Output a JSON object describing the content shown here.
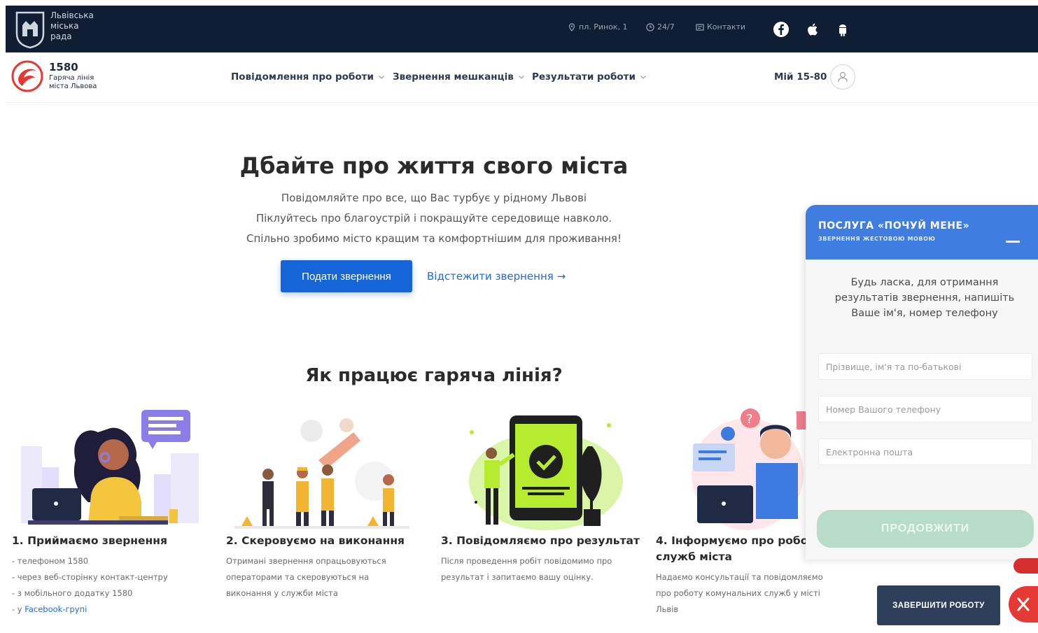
{
  "topbar": {
    "city_name_lines": [
      "Львівська",
      "міська",
      "рада"
    ],
    "address": "пл. Ринок, 1",
    "hours": "24/7",
    "contacts": "Контакти",
    "icons": [
      "location-icon",
      "clock-icon",
      "contacts-icon",
      "facebook-icon",
      "apple-icon",
      "android-icon"
    ]
  },
  "navbar": {
    "hotline_number": "1580",
    "hotline_sub_lines": [
      "Гаряча лінія",
      "міста Львова"
    ],
    "menu": [
      {
        "label": "Повідомлення про роботи"
      },
      {
        "label": "Звернення мешканців"
      },
      {
        "label": "Результати роботи"
      }
    ],
    "my_label": "Мій 15-80"
  },
  "hero": {
    "title": "Дбайте про життя свого міста",
    "lines": [
      "Повідомляйте про все, що Вас турбує у рідному Львові",
      "Піклуйтесь про благоустрій і покращуйте середовище навколо.",
      "Спільно зробимо місто кращим та комфортнішим для проживання!"
    ],
    "primary_button": "Подати звернення",
    "track_link": "Відстежити звернення →"
  },
  "how": {
    "title": "Як працює гаряча лінія?",
    "steps": [
      {
        "title": "1. Приймаємо звернення",
        "lines": [
          "- телефоном 1580",
          "- через веб-сторінку контакт-центру",
          "- з мобільного додатку 1580"
        ],
        "last_prefix": "- у ",
        "last_link": "Facebook-групі"
      },
      {
        "title": "2. Скеровуємо на виконання",
        "lines": [
          "Отримані звернення опрацьовуються",
          "операторами та скеровуються на",
          "виконання у служби міста"
        ]
      },
      {
        "title": "3. Повідомляємо про результат",
        "lines": [
          "Після проведення робіт повідомимо про",
          "результат і запитаємо вашу оцінку."
        ]
      },
      {
        "title_lines": [
          "4. Інформуємо про робо",
          "служб міста"
        ],
        "lines": [
          "Надаємо консультації та повідомляємо",
          "про роботу комунальних служб у місті",
          "Львів"
        ]
      }
    ]
  },
  "widget": {
    "title": "ПОСЛУГА «ПОЧУЙ МЕНЕ»",
    "subtitle": "ЗВЕРНЕННЯ ЖЕСТОВОЮ МОВОЮ",
    "message": "Будь ласка, для отримання результатів звернення, напишіть Ваше ім'я, номер телефону",
    "fields": {
      "name_placeholder": "Прізвище, ім'я та по-батькові",
      "phone_placeholder": "Номер Вашого телефону",
      "email_placeholder": "Електронна пошта"
    },
    "submit": "ПРОДОВЖИТИ"
  },
  "finish_button": "ЗАВЕРШИТИ РОБОТУ",
  "colors": {
    "topbar_bg": "#0f1e33",
    "primary": "#1565d8",
    "widget_header": "#3f7ee0",
    "disabled_green": "#b7ddc9",
    "finish_bg": "#2e3f5c",
    "close_red": "#e53935"
  }
}
